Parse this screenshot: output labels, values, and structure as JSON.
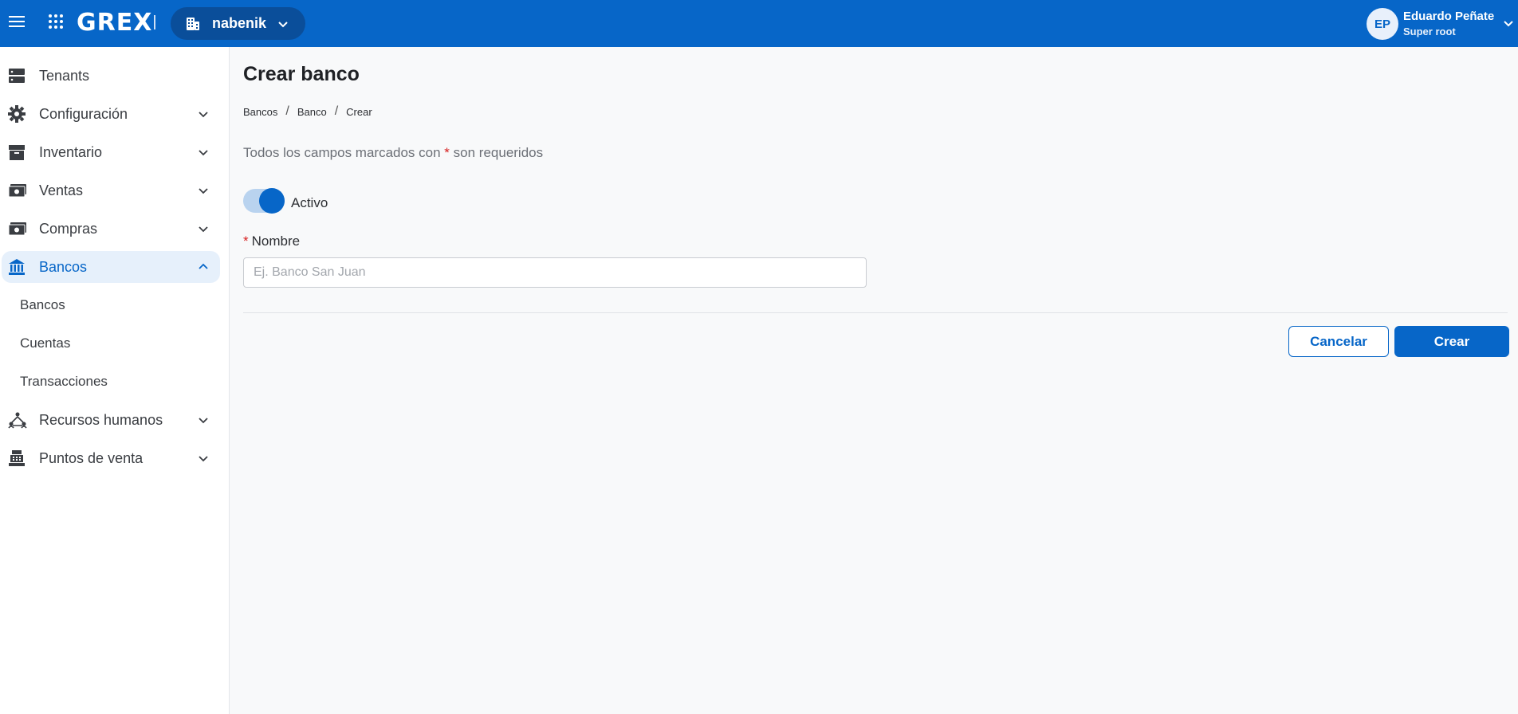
{
  "header": {
    "logo": "GREX",
    "tenant": "nabenik",
    "user": {
      "initials": "EP",
      "name": "Eduardo Peñate",
      "role": "Super root"
    }
  },
  "sidebar": {
    "items": [
      {
        "label": "Tenants",
        "icon": "server-icon"
      },
      {
        "label": "Configuración",
        "icon": "gear-icon"
      },
      {
        "label": "Inventario",
        "icon": "archive-icon"
      },
      {
        "label": "Ventas",
        "icon": "cash-icon"
      },
      {
        "label": "Compras",
        "icon": "cash-icon"
      },
      {
        "label": "Bancos",
        "icon": "bank-icon"
      },
      {
        "label": "Recursos humanos",
        "icon": "people-network-icon"
      },
      {
        "label": "Puntos de venta",
        "icon": "cash-register-icon"
      }
    ],
    "bancos_sub": [
      "Bancos",
      "Cuentas",
      "Transacciones"
    ]
  },
  "main": {
    "title": "Crear banco",
    "breadcrumb": [
      "Bancos",
      "Banco",
      "Crear"
    ],
    "required_note_pre": "Todos los campos marcados con",
    "required_star": "*",
    "required_note_post": "son requeridos",
    "toggle_label": "Activo",
    "toggle_on": true,
    "field_label": "Nombre",
    "field_placeholder": "Ej. Banco San Juan",
    "field_value": "",
    "cancel_label": "Cancelar",
    "create_label": "Crear"
  },
  "colors": {
    "primary": "#0766c8",
    "active_bg": "#e6f0fb",
    "required": "#d62020"
  }
}
